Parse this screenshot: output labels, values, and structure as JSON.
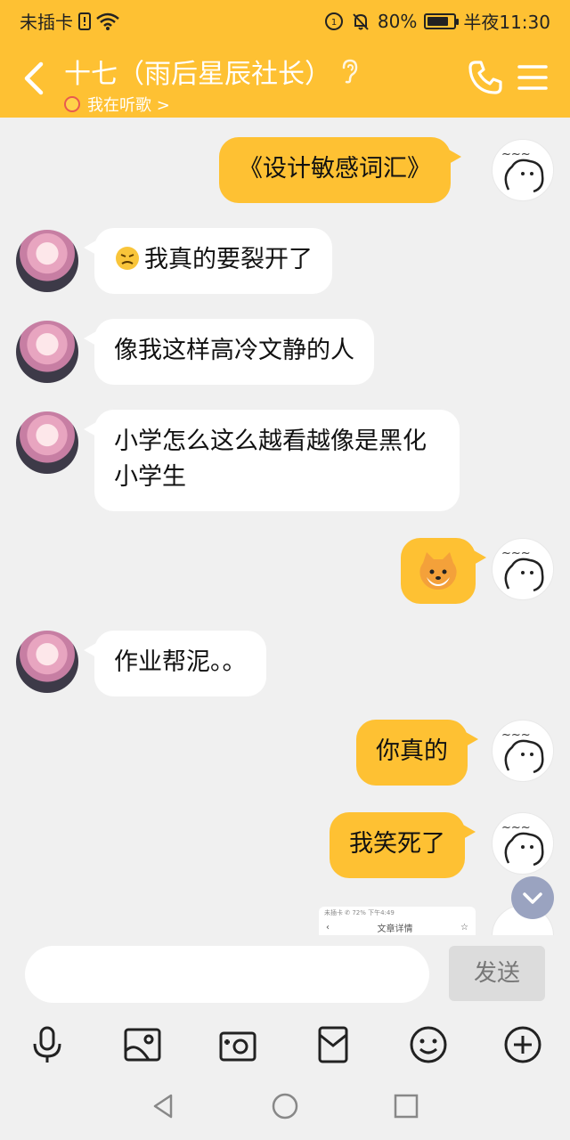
{
  "status_bar": {
    "carrier": "未插卡",
    "battery": "80%",
    "battery_level": 0.8,
    "time": "半夜11:30"
  },
  "header": {
    "title": "十七（雨后星辰社长）",
    "status": "我在听歌 >"
  },
  "messages": [
    {
      "side": "out",
      "text": "《设计敏感词汇》"
    },
    {
      "side": "in",
      "text": "我真的要裂开了",
      "emoji": "frustrated-emoji"
    },
    {
      "side": "in",
      "text": "像我这样高冷文静的人"
    },
    {
      "side": "in",
      "text": "小学怎么这么越看越像是黑化小学生"
    },
    {
      "side": "out",
      "sticker": "shiba-dog-emoji"
    },
    {
      "side": "in",
      "text": "作业帮泥。。"
    },
    {
      "side": "out",
      "text": "你真的"
    },
    {
      "side": "out",
      "text": "我笑死了"
    },
    {
      "side": "out",
      "preview": {
        "status": "未插卡 ✆ 72% 下午4:49",
        "title": "文章详情"
      }
    }
  ],
  "input": {
    "placeholder": "",
    "send_label": "发送"
  },
  "tools": [
    "microphone-icon",
    "image-icon",
    "camera-icon",
    "red-packet-icon",
    "emoji-icon",
    "plus-icon"
  ],
  "colors": {
    "accent": "#fec133",
    "background": "#f0f0f0",
    "bubble_in": "#ffffff",
    "bubble_out": "#fec133"
  }
}
